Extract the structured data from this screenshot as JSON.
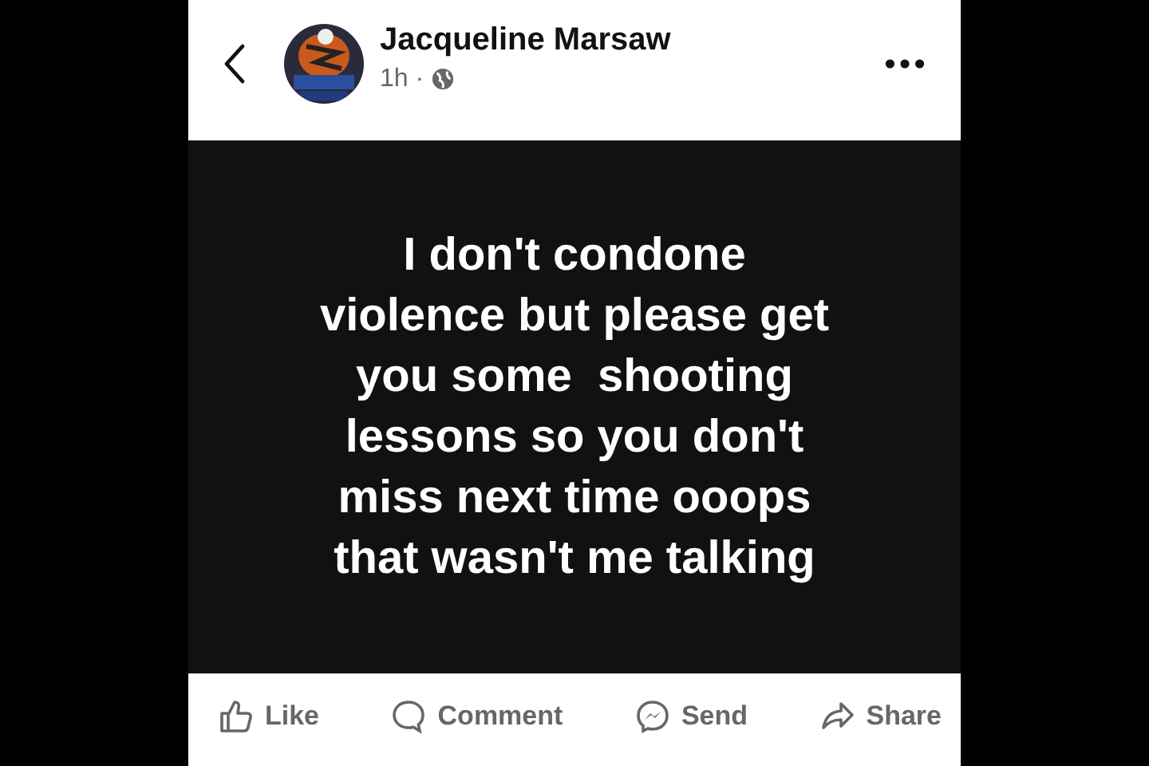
{
  "post": {
    "author": "Jacqueline Marsaw",
    "time": "1h ·",
    "text_lines": [
      "I don't condone",
      "violence but please get",
      "you some  shooting",
      "lessons so you don't",
      "miss next time ooops",
      "that wasn't me talking"
    ]
  },
  "actions": [
    {
      "kind": "like",
      "label": "Like"
    },
    {
      "kind": "comment",
      "label": "Comment"
    },
    {
      "kind": "send",
      "label": "Send"
    },
    {
      "kind": "share",
      "label": "Share"
    }
  ]
}
